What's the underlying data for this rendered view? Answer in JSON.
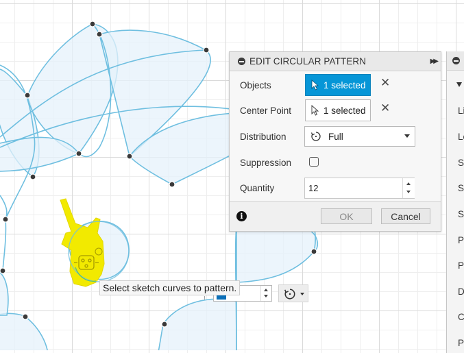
{
  "dialog": {
    "title": "EDIT CIRCULAR PATTERN",
    "rows": {
      "objects": {
        "label": "Objects",
        "value": "1 selected"
      },
      "center_point": {
        "label": "Center Point",
        "value": "1 selected"
      },
      "distribution": {
        "label": "Distribution",
        "value": "Full"
      },
      "suppression": {
        "label": "Suppression",
        "checked": false
      },
      "quantity": {
        "label": "Quantity",
        "value": "12"
      }
    },
    "ok_label": "OK",
    "cancel_label": "Cancel"
  },
  "right_panel": {
    "items": [
      "Li",
      "Lo",
      "Sh",
      "Sn",
      "Sh",
      "Pr",
      "Po",
      "Di",
      "Co",
      "Pr"
    ]
  },
  "tooltip": "Select sketch curves to pattern.",
  "colors": {
    "accent": "#0696d7",
    "curve": "#6fbfe0",
    "fill": "#e6f2fb",
    "highlight": "#f2ea00"
  },
  "icons": {
    "collapse": "minus-circle-icon",
    "expand": "double-chevron-right-icon",
    "select": "cursor-arrow-icon",
    "clear": "close-x-icon",
    "distribution": "full-circle-arrow-icon",
    "info": "info-icon"
  }
}
